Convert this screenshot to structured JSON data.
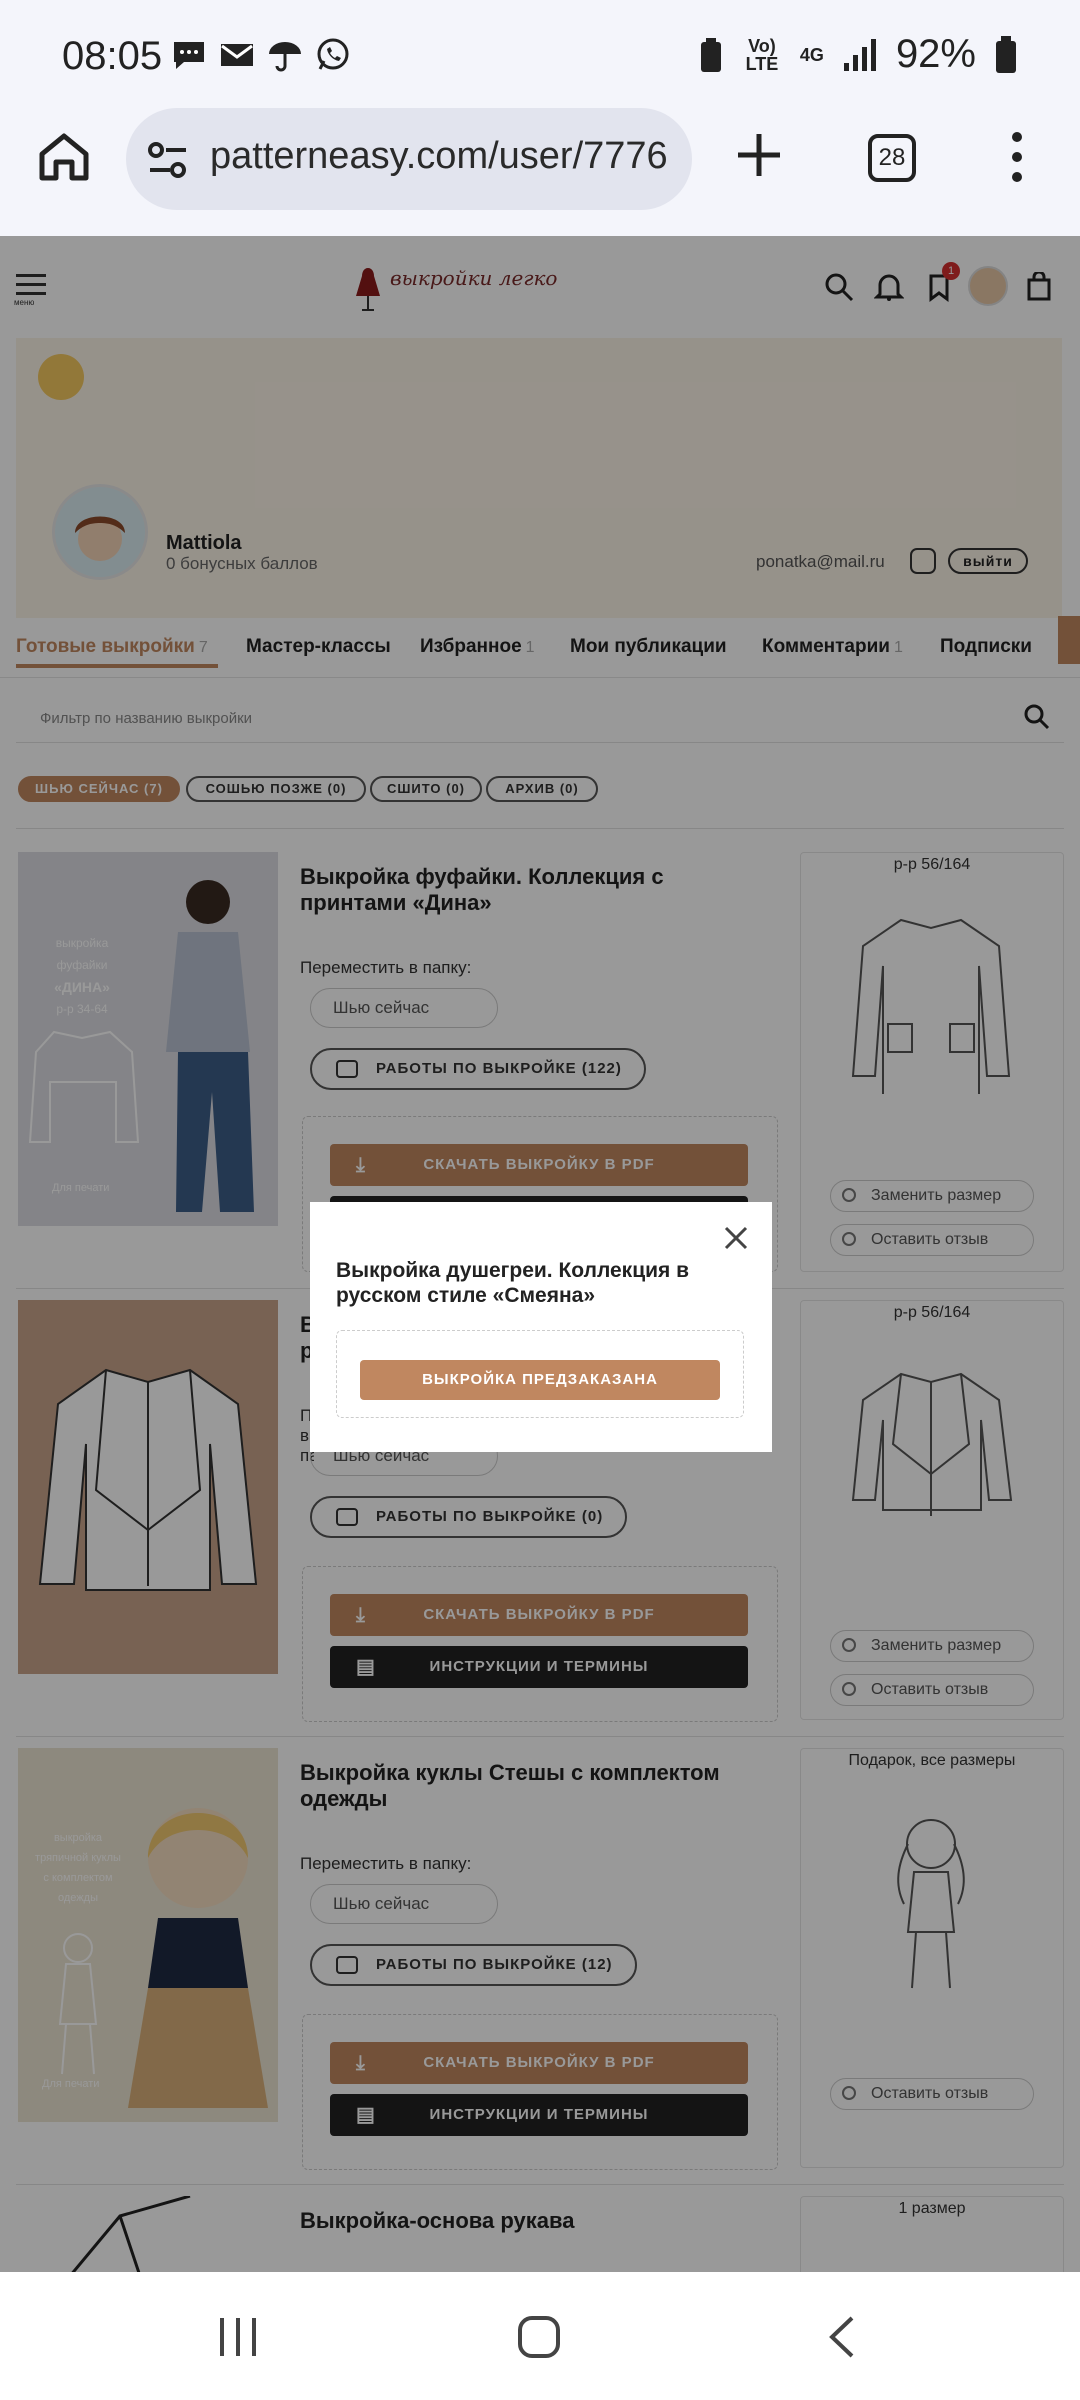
{
  "status_bar": {
    "time": "08:05",
    "notification_icons": [
      "chat-icon",
      "mail-icon",
      "umbrella-icon",
      "whatsapp-icon"
    ],
    "network_volte": "Vo) LTE",
    "network_4g": "4G",
    "battery": "92%"
  },
  "browser": {
    "url": "patterneasy.com/user/7776",
    "tab_count": "28"
  },
  "site": {
    "logo_text": "выкройки легко",
    "menu_label": "меню",
    "wishlist_count": "1"
  },
  "profile": {
    "name": "Mattiola",
    "bonus": "0 бонусных баллов",
    "email": "ponatka@mail.ru",
    "logout": "выйти"
  },
  "tabs": [
    {
      "label": "Готовые выкройки",
      "count": "7",
      "active": true
    },
    {
      "label": "Мастер-классы",
      "count": ""
    },
    {
      "label": "Избранное",
      "count": "1"
    },
    {
      "label": "Мои публикации",
      "count": ""
    },
    {
      "label": "Комментарии",
      "count": "1"
    },
    {
      "label": "Подписки",
      "count": ""
    }
  ],
  "filter": {
    "placeholder": "Фильтр по названию выкройки"
  },
  "chips": [
    {
      "label": "ШЬЮ СЕЙЧАС (7)",
      "active": true
    },
    {
      "label": "СОШЬЮ ПОЗЖЕ (0)"
    },
    {
      "label": "СШИТО (0)"
    },
    {
      "label": "АРХИВ (0)"
    }
  ],
  "common": {
    "move_to_folder": "Переместить в папку:",
    "folder_value": "Шью сейчас",
    "download_pdf": "СКАЧАТЬ ВЫКРОЙКУ В PDF",
    "instructions": "ИНСТРУКЦИИ И ТЕРМИНЫ",
    "replace_size": "Заменить размер",
    "leave_review": "Оставить отзыв"
  },
  "cards": [
    {
      "title": "Выкройка фуфайки. Коллекция с принтами «Дина»",
      "works": "РАБОТЫ ПО ВЫКРОЙКЕ (122)",
      "size": "р-р 56/164",
      "cover_lines": [
        "выкройка",
        "фуфайки",
        "«ДИНА»",
        "р-р 34-64"
      ],
      "cover_footer": "Для печати"
    },
    {
      "title": "Выкройка душегреи. Коллекция в русском стиле «Смеяна»",
      "title_visible": "В р",
      "works": "РАБОТЫ ПО ВЫКРОЙКЕ (0)",
      "size": "р-р 56/164"
    },
    {
      "title": "Выкройка куклы Стешы с комплектом одежды",
      "works": "РАБОТЫ ПО ВЫКРОЙКЕ (12)",
      "size": "Подарок, все размеры",
      "cover_lines": [
        "выкройка",
        "тряпичной куклы",
        "с комплектом",
        "одежды"
      ],
      "cover_footer": "Для печати"
    },
    {
      "title": "Выкройка-основа рукава",
      "size": "1 размер"
    }
  ],
  "modal": {
    "title": "Выкройка душегреи. Коллекция в русском стиле «Смеяна»",
    "button": "ВЫКРОЙКА ПРЕДЗАКАЗАНА"
  },
  "colors": {
    "accent": "#c08760",
    "dark_button": "#222222",
    "profile_bg": "#fbf3e7",
    "card2_bg": "#c9a48a"
  }
}
